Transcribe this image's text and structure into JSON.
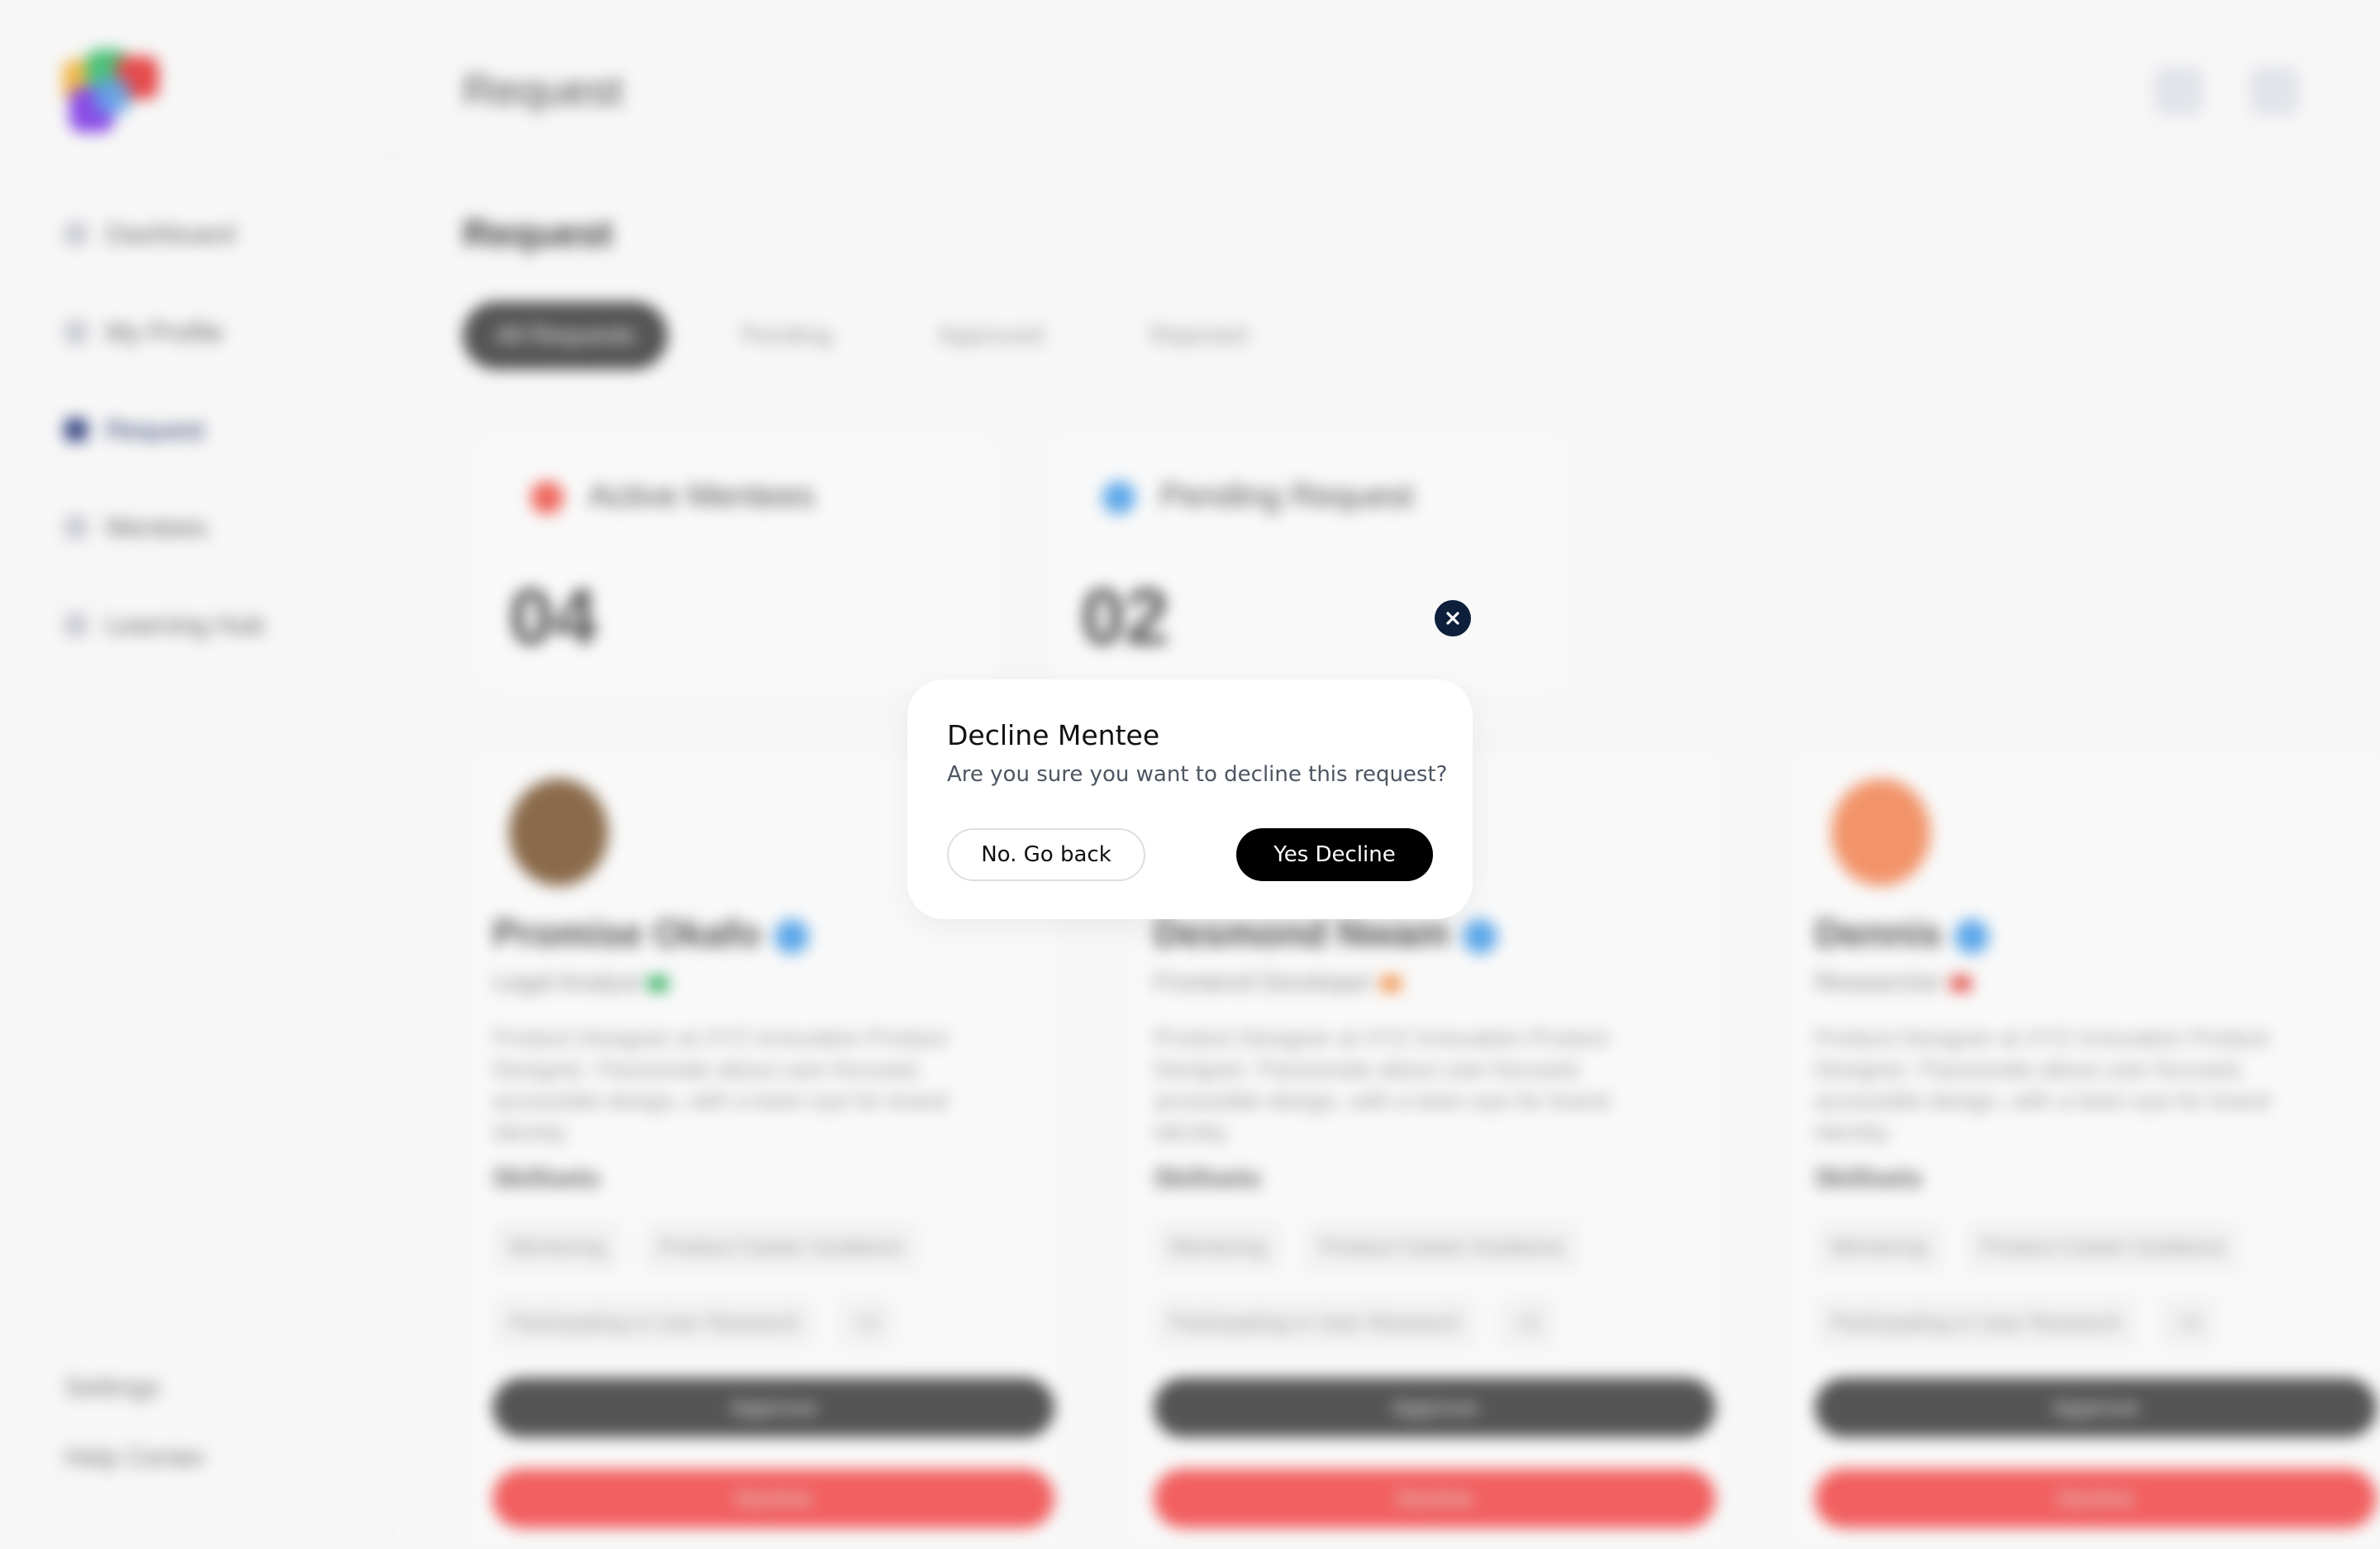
{
  "background": {
    "header_title": "Request",
    "section_title": "Request",
    "tabs": [
      "All Requests",
      "Pending",
      "Approved",
      "Rejected"
    ],
    "sidebar_items": [
      "Dashboard",
      "My Profile",
      "Request",
      "Mentees",
      "Learning Hub"
    ],
    "sidebar_footer": [
      "Settings",
      "Help Center"
    ],
    "stats": [
      {
        "label": "Active Mentees",
        "value": "04",
        "color": "#f0675e"
      },
      {
        "label": "Pending Request",
        "value": "02",
        "color": "#5ea8ea"
      }
    ],
    "cards": [
      {
        "name": "Promise Okafo",
        "role": "Legal Analyst",
        "bio": "Product Designer at XYZ Innovation Product Designer. Passionate about user-focused, accessible design, with a keen eye for brand identity.",
        "skills_label": "Skillsets",
        "tags_row1": [
          "Mentoring",
          "Product Career Guidance"
        ],
        "tags_row2": [
          "Participating in User Research",
          "+2"
        ],
        "approve": "Approve",
        "decline": "Decline",
        "avatar_color": "#8a6a4a",
        "flag_color": "#2fae5f"
      },
      {
        "name": "Desmond Nwam",
        "role": "Frontend Developer",
        "bio": "Product Designer at XYZ Innovation Product Designer. Passionate about user-focused, accessible design, with a keen eye for brand identity.",
        "skills_label": "Skillsets",
        "tags_row1": [
          "Mentoring",
          "Product Career Guidance"
        ],
        "tags_row2": [
          "Participating in User Research",
          "+2"
        ],
        "approve": "Approve",
        "decline": "Decline",
        "avatar_color": "#f3f3f3",
        "flag_color": "#f08a3e"
      },
      {
        "name": "Dennis",
        "role": "Researcher",
        "bio": "Product Designer at XYZ Innovation Product Designer. Passionate about user-focused, accessible design, with a keen eye for brand identity.",
        "skills_label": "Skillsets",
        "tags_row1": [
          "Mentoring",
          "Product Career Guidance"
        ],
        "tags_row2": [
          "Participating in User Research",
          "+2"
        ],
        "approve": "Approve",
        "decline": "Decline",
        "avatar_color": "#f2946a",
        "flag_color": "#e0443c"
      }
    ]
  },
  "modal": {
    "title": "Decline Mentee",
    "message": "Are you sure you want to decline this request?",
    "back_label": "No. Go back",
    "confirm_label": "Yes Decline",
    "close_icon": "close-icon"
  },
  "colors": {
    "accent_dark": "#0d1f3a",
    "confirm_bg": "#000000",
    "decline_red": "#f26060"
  }
}
